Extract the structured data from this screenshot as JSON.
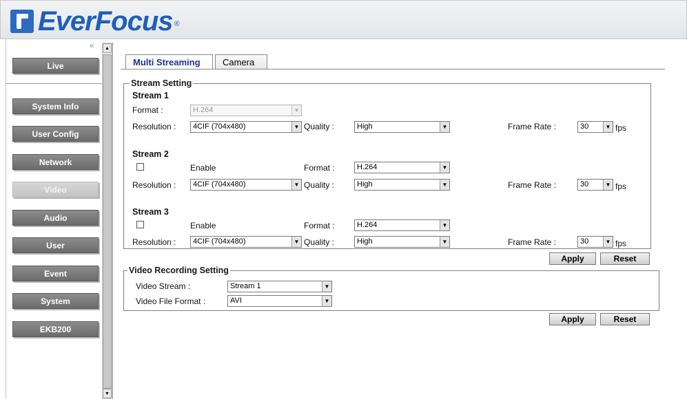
{
  "brand": {
    "name": "EverFocus",
    "reg": "®",
    "accent": "#1f5fb8"
  },
  "sidebar": {
    "collapse": "«",
    "items": [
      {
        "label": "Live"
      },
      {
        "label": "System Info"
      },
      {
        "label": "User Config"
      },
      {
        "label": "Network"
      },
      {
        "label": "Video",
        "active": true
      },
      {
        "label": "Audio"
      },
      {
        "label": "User"
      },
      {
        "label": "Event"
      },
      {
        "label": "System"
      },
      {
        "label": "EKB200"
      }
    ]
  },
  "tabs": [
    {
      "label": "Multi Streaming",
      "active": true
    },
    {
      "label": "Camera"
    }
  ],
  "stream_setting": {
    "legend": "Stream Setting",
    "stream1": {
      "title": "Stream 1",
      "format_label": "Format :",
      "format_value": "H.264",
      "resolution_label": "Resolution :",
      "resolution_value": "4CIF (704x480)",
      "quality_label": "Quality :",
      "quality_value": "High",
      "frame_rate_label": "Frame Rate :",
      "frame_rate_value": "30",
      "fps": "fps"
    },
    "stream2": {
      "title": "Stream 2",
      "enable_label": "Enable",
      "format_label": "Format :",
      "format_value": "H.264",
      "resolution_label": "Resolution :",
      "resolution_value": "4CIF (704x480)",
      "quality_label": "Quality :",
      "quality_value": "High",
      "frame_rate_label": "Frame Rate :",
      "frame_rate_value": "30",
      "fps": "fps"
    },
    "stream3": {
      "title": "Stream 3",
      "enable_label": "Enable",
      "format_label": "Format :",
      "format_value": "H.264",
      "resolution_label": "Resolution :",
      "resolution_value": "4CIF (704x480)",
      "quality_label": "Quality :",
      "quality_value": "High",
      "frame_rate_label": "Frame Rate :",
      "frame_rate_value": "30",
      "fps": "fps"
    },
    "apply": "Apply",
    "reset": "Reset"
  },
  "recording_setting": {
    "legend": "Video Recording Setting",
    "video_stream_label": "Video Stream :",
    "video_stream_value": "Stream 1",
    "file_format_label": "Video File Format :",
    "file_format_value": "AVI",
    "apply": "Apply",
    "reset": "Reset"
  }
}
